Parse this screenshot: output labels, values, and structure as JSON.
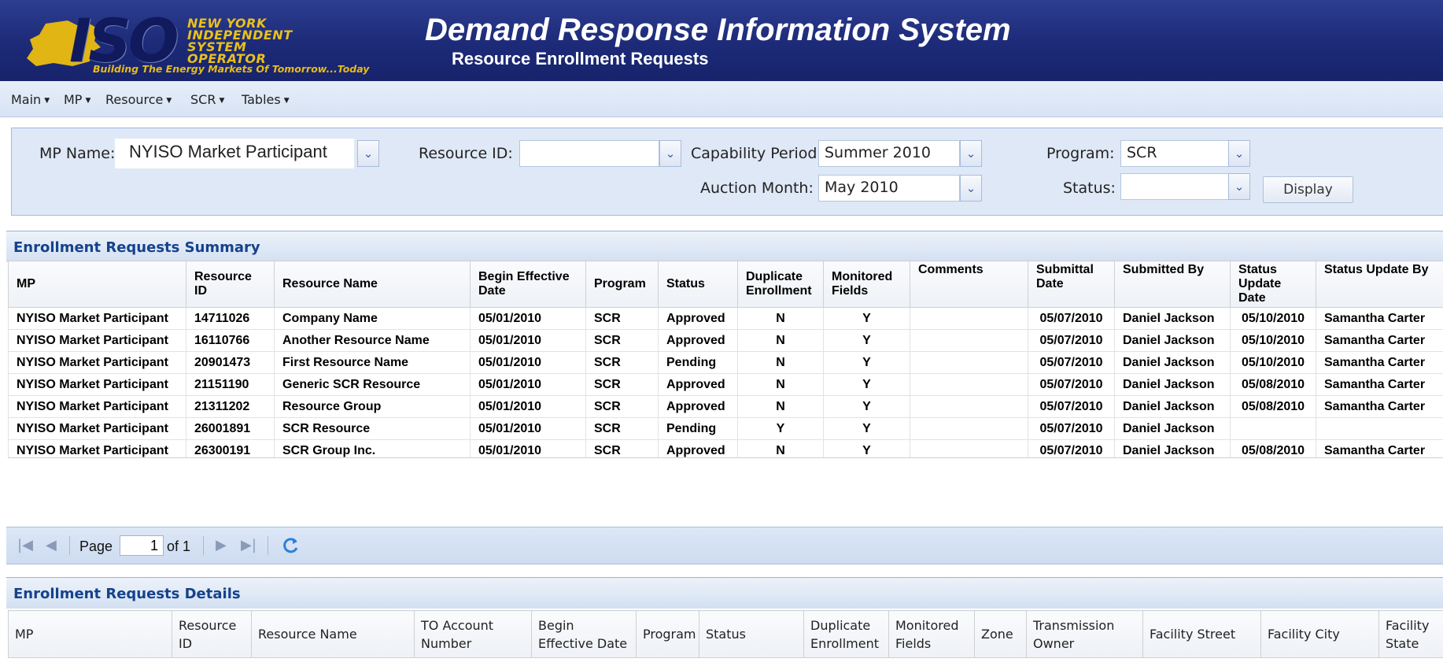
{
  "header": {
    "logo_text": "ISO",
    "org_name": "NEW YORK INDEPENDENT SYSTEM OPERATOR",
    "tagline": "Building The Energy Markets Of Tomorrow...Today",
    "app_title": "Demand Response Information System",
    "page_title": "Resource Enrollment Requests"
  },
  "menu": [
    "Main",
    "MP",
    "Resource",
    "SCR",
    "Tables"
  ],
  "filters": {
    "mp_name": {
      "label": "MP Name:",
      "value": "NYISO Market Participant"
    },
    "resource_id": {
      "label": "Resource ID:",
      "value": ""
    },
    "capability_period": {
      "label": "Capability Period:",
      "value": "Summer 2010"
    },
    "auction_month": {
      "label": "Auction Month:",
      "value": "May 2010"
    },
    "program": {
      "label": "Program:",
      "value": "SCR"
    },
    "status": {
      "label": "Status:",
      "value": ""
    },
    "display_label": "Display"
  },
  "summary": {
    "title": "Enrollment Requests Summary",
    "columns": [
      "MP",
      "Resource ID",
      "Resource Name",
      "Begin Effective Date",
      "Program",
      "Status",
      "Duplicate Enrollment",
      "Monitored Fields",
      "Comments",
      "Submittal Date",
      "Submitted By",
      "Status Update Date",
      "Status Update By"
    ],
    "rows": [
      [
        "NYISO Market Participant",
        "14711026",
        "Company Name",
        "05/01/2010",
        "SCR",
        "Approved",
        "N",
        "Y",
        "",
        "05/07/2010",
        "Daniel Jackson",
        "05/10/2010",
        "Samantha Carter"
      ],
      [
        "NYISO Market Participant",
        "16110766",
        "Another Resource Name",
        "05/01/2010",
        "SCR",
        "Approved",
        "N",
        "Y",
        "",
        "05/07/2010",
        "Daniel Jackson",
        "05/10/2010",
        "Samantha Carter"
      ],
      [
        "NYISO Market Participant",
        "20901473",
        "First Resource Name",
        "05/01/2010",
        "SCR",
        "Pending",
        "N",
        "Y",
        "",
        "05/07/2010",
        "Daniel Jackson",
        "05/10/2010",
        "Samantha Carter"
      ],
      [
        "NYISO Market Participant",
        "21151190",
        "Generic SCR Resource",
        "05/01/2010",
        "SCR",
        "Approved",
        "N",
        "Y",
        "",
        "05/07/2010",
        "Daniel Jackson",
        "05/08/2010",
        "Samantha Carter"
      ],
      [
        "NYISO Market Participant",
        "21311202",
        "Resource Group",
        "05/01/2010",
        "SCR",
        "Approved",
        "N",
        "Y",
        "",
        "05/07/2010",
        "Daniel Jackson",
        "05/08/2010",
        "Samantha Carter"
      ],
      [
        "NYISO Market Participant",
        "26001891",
        "SCR Resource",
        "05/01/2010",
        "SCR",
        "Pending",
        "Y",
        "Y",
        "",
        "05/07/2010",
        "Daniel Jackson",
        "",
        ""
      ],
      [
        "NYISO Market Participant",
        "26300191",
        "SCR Group Inc.",
        "05/01/2010",
        "SCR",
        "Approved",
        "N",
        "Y",
        "",
        "05/07/2010",
        "Daniel Jackson",
        "05/08/2010",
        "Samantha Carter"
      ]
    ]
  },
  "pager": {
    "page_label": "Page",
    "current_page": "1",
    "of_label": "of 1"
  },
  "details": {
    "title": "Enrollment Requests Details",
    "columns": [
      "MP",
      "Resource ID",
      "Resource Name",
      "TO Account Number",
      "Begin Effective Date",
      "Program",
      "Status",
      "Duplicate Enrollment",
      "Monitored Fields",
      "Zone",
      "Transmission Owner",
      "Facility Street",
      "Facility City",
      "Facility State"
    ]
  },
  "colors": {
    "header_bg": "#1c2a78",
    "panel_title": "#15428b",
    "logo_gold": "#e6bb19"
  }
}
